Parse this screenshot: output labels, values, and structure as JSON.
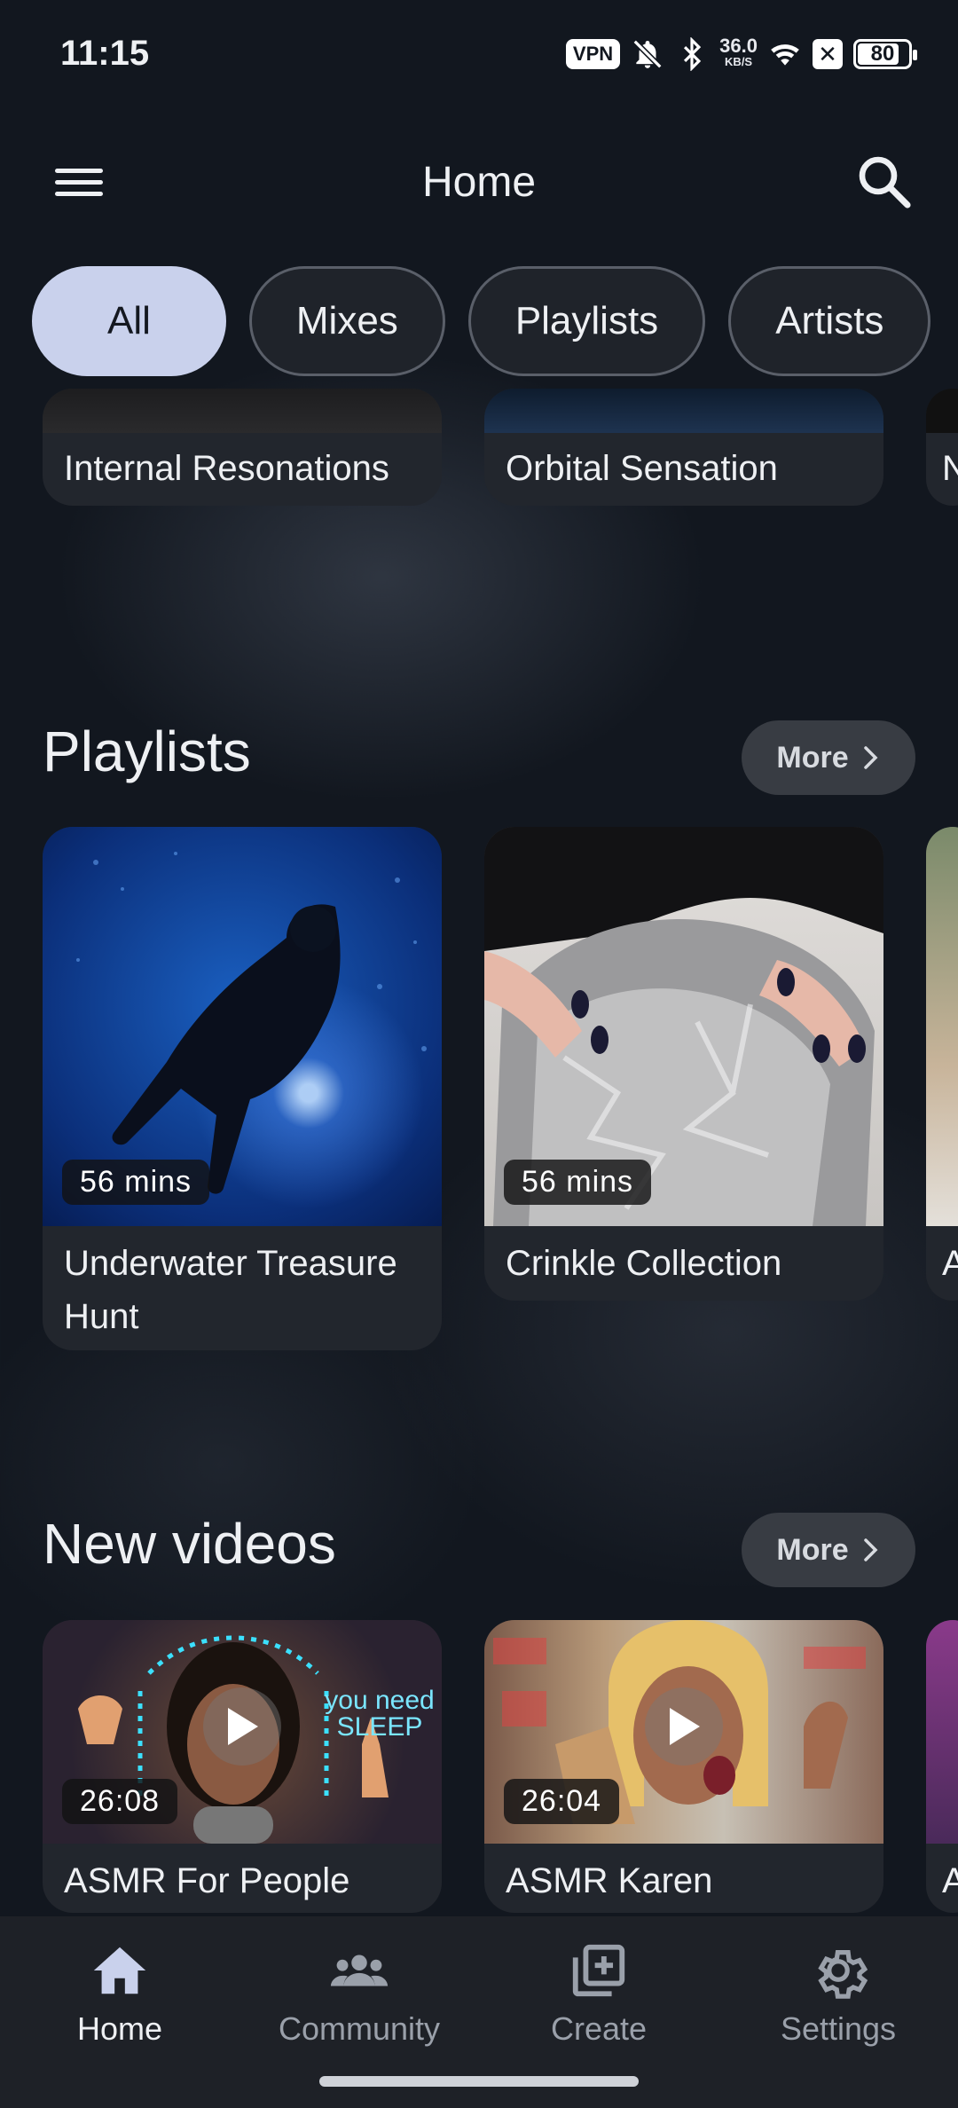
{
  "status_bar": {
    "time": "11:15",
    "vpn_label": "VPN",
    "net_speed_value": "36.0",
    "net_speed_unit": "KB/S",
    "x_badge": "✕",
    "battery": "80"
  },
  "app_bar": {
    "title": "Home",
    "menu_icon": "hamburger-menu-icon",
    "search_icon": "search-icon"
  },
  "chips": [
    {
      "label": "All",
      "active": true
    },
    {
      "label": "Mixes",
      "active": false
    },
    {
      "label": "Playlists",
      "active": false
    },
    {
      "label": "Artists",
      "active": false
    }
  ],
  "top_row": [
    {
      "title": "Internal Resonations"
    },
    {
      "title": "Orbital Sensation"
    },
    {
      "title": "N"
    }
  ],
  "playlists": {
    "heading": "Playlists",
    "more_label": "More",
    "items": [
      {
        "title": "Underwater Treasure Hunt",
        "duration": "56 mins"
      },
      {
        "title": "Crinkle Collection",
        "duration": "56 mins"
      },
      {
        "title": "A",
        "duration": ""
      }
    ]
  },
  "new_videos": {
    "heading": "New videos",
    "more_label": "More",
    "items": [
      {
        "title": "ASMR For People",
        "duration": "26:08",
        "overlay_line1": "you need",
        "overlay_line2": "SLEEP"
      },
      {
        "title": "ASMR Karen",
        "duration": "26:04"
      },
      {
        "title": "A",
        "duration": ""
      }
    ]
  },
  "bottom_nav": [
    {
      "label": "Home",
      "icon": "home-icon",
      "active": true
    },
    {
      "label": "Community",
      "icon": "community-icon",
      "active": false
    },
    {
      "label": "Create",
      "icon": "add-box-icon",
      "active": false
    },
    {
      "label": "Settings",
      "icon": "gear-icon",
      "active": false
    }
  ],
  "colors": {
    "background": "#12171f",
    "card": "#22262d",
    "active_chip": "#c9d1ec",
    "nav_bar": "#1e2127"
  }
}
